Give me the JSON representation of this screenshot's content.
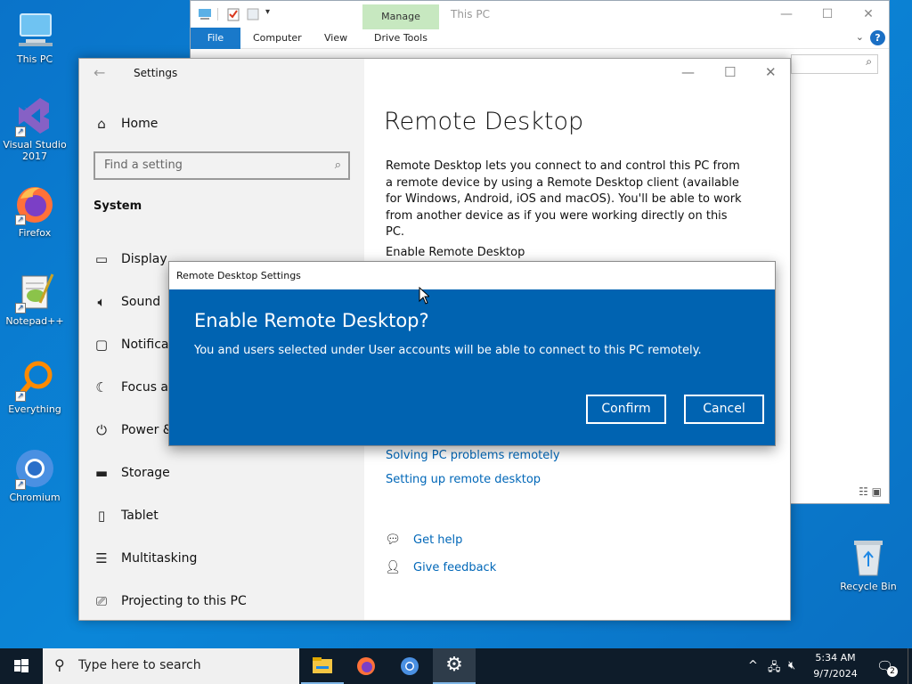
{
  "desktop": {
    "icons": [
      {
        "label": "This PC"
      },
      {
        "label": "Visual Studio 2017"
      },
      {
        "label": "Firefox"
      },
      {
        "label": "Notepad++"
      },
      {
        "label": "Everything"
      },
      {
        "label": "Chromium"
      },
      {
        "label": "Recycle Bin"
      }
    ]
  },
  "explorer": {
    "title": "This PC",
    "manage_tab": "Manage",
    "tabs": {
      "file": "File",
      "computer": "Computer",
      "view": "View",
      "drive_tools": "Drive Tools"
    },
    "help": "?"
  },
  "settings": {
    "app_title": "Settings",
    "home": "Home",
    "search_placeholder": "Find a setting",
    "section": "System",
    "nav": [
      {
        "label": "Display",
        "icon": "display-icon"
      },
      {
        "label": "Sound",
        "icon": "sound-icon"
      },
      {
        "label": "Notificati",
        "icon": "notifications-icon"
      },
      {
        "label": "Focus ass",
        "icon": "focus-assist-icon"
      },
      {
        "label": "Power &",
        "icon": "power-icon"
      },
      {
        "label": "Storage",
        "icon": "storage-icon"
      },
      {
        "label": "Tablet",
        "icon": "tablet-icon"
      },
      {
        "label": "Multitasking",
        "icon": "multitasking-icon"
      },
      {
        "label": "Projecting to this PC",
        "icon": "projecting-icon"
      }
    ],
    "page_title": "Remote Desktop",
    "description": "Remote Desktop lets you connect to and control this PC from a remote device by using a Remote Desktop client (available for Windows, Android, iOS and macOS). You'll be able to work from another device as if you were working directly on this PC.",
    "enable_label": "Enable Remote Desktop",
    "links": [
      "Solving PC problems remotely",
      "Setting up remote desktop"
    ],
    "get_help": "Get help",
    "give_feedback": "Give feedback"
  },
  "dialog": {
    "title": "Remote Desktop Settings",
    "heading": "Enable Remote Desktop?",
    "message": "You and users selected under User accounts will be able to connect to this PC remotely.",
    "confirm": "Confirm",
    "cancel": "Cancel"
  },
  "taskbar": {
    "search_placeholder": "Type here to search",
    "time": "5:34 AM",
    "date": "9/7/2024",
    "notification_count": "2"
  },
  "colors": {
    "dialog_blue": "#0063b1",
    "link_blue": "#0067b8",
    "desktop_blue": "#0b86d8",
    "taskbar": "#0e1c2a"
  }
}
